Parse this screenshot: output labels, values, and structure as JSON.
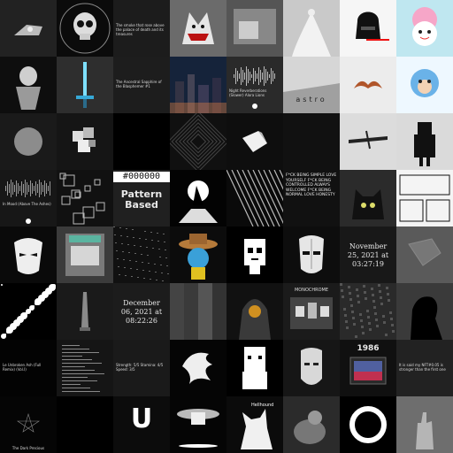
{
  "tiles": [
    {
      "name": "tile-r1c1",
      "bg": "#1a1a1a",
      "motif": "spaceship"
    },
    {
      "name": "tile-r1c2",
      "bg": "#0b0b0b",
      "motif": "skull"
    },
    {
      "name": "tile-r1c3",
      "bg": "#1c1c1c",
      "motif": "tiny-caption",
      "caption": "The smoke that rose above the palace of death and its treasures"
    },
    {
      "name": "tile-r1c4",
      "bg": "#6b6b6b",
      "motif": "wolf"
    },
    {
      "name": "tile-r1c5",
      "bg": "#444",
      "motif": "photo"
    },
    {
      "name": "tile-r1c6",
      "bg": "#bdbdbd",
      "motif": "dancer"
    },
    {
      "name": "tile-r1c7",
      "bg": "#f4f4f4",
      "motif": "vader"
    },
    {
      "name": "tile-r1c8",
      "bg": "#a6e0ee",
      "motif": "cute"
    },
    {
      "name": "tile-r2c1",
      "bg": "#0e0e0e",
      "motif": "figure"
    },
    {
      "name": "tile-r2c2",
      "bg": "#2e2e2e",
      "motif": "sword"
    },
    {
      "name": "tile-r2c3",
      "bg": "#1d1d1d",
      "motif": "tiny-caption",
      "caption": "The Ancestral Sapphire of the Blasphemer #1"
    },
    {
      "name": "tile-r2c4",
      "bg": "#1f2a3a",
      "motif": "city"
    },
    {
      "name": "tile-r2c5",
      "bg": "#2a2a2a",
      "motif": "audio",
      "caption": "Night Reverberations (Slower) Alora Lions"
    },
    {
      "name": "tile-r2c6",
      "bg": "#d6d6d6",
      "motif": "astro",
      "caption": "astro"
    },
    {
      "name": "tile-r2c7",
      "bg": "#e4e4e4",
      "motif": "mustache"
    },
    {
      "name": "tile-r2c8",
      "bg": "#e9f6ff",
      "motif": "ape"
    },
    {
      "name": "tile-r3c1",
      "bg": "#1a1a1a",
      "motif": "circle"
    },
    {
      "name": "tile-r3c2",
      "bg": "#151515",
      "motif": "cubes"
    },
    {
      "name": "tile-r3c3",
      "bg": "#000000",
      "motif": "blank"
    },
    {
      "name": "tile-r3c4",
      "bg": "#101010",
      "motif": "concentric"
    },
    {
      "name": "tile-r3c5",
      "bg": "#0e0e0e",
      "motif": "origami"
    },
    {
      "name": "tile-r3c6",
      "bg": "#111111",
      "motif": "blank"
    },
    {
      "name": "tile-r3c7",
      "bg": "#dcdcdc",
      "motif": "plane"
    },
    {
      "name": "tile-r3c8",
      "bg": "#d9d9d9",
      "motif": "pixel-person"
    },
    {
      "name": "tile-r4c1",
      "bg": "#171717",
      "motif": "audio2",
      "caption": "In Mood (Above The Ashes)"
    },
    {
      "name": "tile-r4c2",
      "bg": "#111111",
      "motif": "squares"
    },
    {
      "name": "tile-r4c3",
      "bg": "#202020",
      "motif": "hex-text",
      "caption": "#000000",
      "caption2": "Pattern Based"
    },
    {
      "name": "tile-r4c4",
      "bg": "#030303",
      "motif": "witch"
    },
    {
      "name": "tile-r4c5",
      "bg": "#0a0a0a",
      "motif": "maze"
    },
    {
      "name": "tile-r4c6",
      "bg": "#111111",
      "motif": "text-wall",
      "caption": "F*CK BEING SIMPLE LOVE YOURSELF F*CK BEING CONTROLLED ALWAYS WELCOME F*CK BEING NORMAL LOVE HONESTY"
    },
    {
      "name": "tile-r4c7",
      "bg": "#2b2b2b",
      "motif": "cat"
    },
    {
      "name": "tile-r4c8",
      "bg": "#f2f2f2",
      "motif": "comic"
    },
    {
      "name": "tile-r5c1",
      "bg": "#0a0a0a",
      "motif": "mask"
    },
    {
      "name": "tile-r5c2",
      "bg": "#3b3b3b",
      "motif": "box"
    },
    {
      "name": "tile-r5c3",
      "bg": "#111111",
      "motif": "noise"
    },
    {
      "name": "tile-r5c4",
      "bg": "#0c0c0c",
      "motif": "cowboy"
    },
    {
      "name": "tile-r5c5",
      "bg": "#000000",
      "motif": "punk"
    },
    {
      "name": "tile-r5c6",
      "bg": "#0d0d0d",
      "motif": "mask2"
    },
    {
      "name": "tile-r5c7",
      "bg": "#181818",
      "motif": "date-text",
      "caption": "November 25, 2021 at 03:27:19"
    },
    {
      "name": "tile-r5c8",
      "bg": "#5a5a5a",
      "motif": "emboss"
    },
    {
      "name": "tile-r6c1",
      "bg": "#000000",
      "motif": "splatter"
    },
    {
      "name": "tile-r6c2",
      "bg": "#1a1a1a",
      "motif": "spire"
    },
    {
      "name": "tile-r6c3",
      "bg": "#1c1c1c",
      "motif": "date-text",
      "caption": "December 06, 2021 at 08:22:26"
    },
    {
      "name": "tile-r6c4",
      "bg": "#222222",
      "motif": "blur"
    },
    {
      "name": "tile-r6c5",
      "bg": "#111111",
      "motif": "hooded"
    },
    {
      "name": "tile-r6c6",
      "bg": "#1b1b1b",
      "motif": "gallery",
      "caption": "MONOCHROME"
    },
    {
      "name": "tile-r6c7",
      "bg": "#2a2a2a",
      "motif": "noise2"
    },
    {
      "name": "tile-r6c8",
      "bg": "#3a3a3a",
      "motif": "silhouette"
    },
    {
      "name": "tile-r7c1",
      "bg": "#030303",
      "motif": "mono-text",
      "caption": "Le Unbroken Ash (Full Remix) (Vol.I)"
    },
    {
      "name": "tile-r7c2",
      "bg": "#151515",
      "motif": "ascii"
    },
    {
      "name": "tile-r7c3",
      "bg": "#1a1a1a",
      "motif": "list",
      "caption": "Strength: 5/5 Stamina: 4/5 Speed: 3/5"
    },
    {
      "name": "tile-r7c4",
      "bg": "#050505",
      "motif": "dragon"
    },
    {
      "name": "tile-r7c5",
      "bg": "#000000",
      "motif": "pixel-face"
    },
    {
      "name": "tile-r7c6",
      "bg": "#161616",
      "motif": "face"
    },
    {
      "name": "tile-r7c7",
      "bg": "#101010",
      "motif": "tv",
      "caption": "1986"
    },
    {
      "name": "tile-r7c8",
      "bg": "#222222",
      "motif": "tiny-caption",
      "caption": "It is said my NFT#0.05 is stronger than the first one"
    },
    {
      "name": "tile-r8c1",
      "bg": "#050505",
      "motif": "star",
      "caption": "The Dark Precious"
    },
    {
      "name": "tile-r8c2",
      "bg": "#000000",
      "motif": "blank"
    },
    {
      "name": "tile-r8c3",
      "bg": "#0c0c0c",
      "motif": "letter",
      "caption": "U"
    },
    {
      "name": "tile-r8c4",
      "bg": "#050505",
      "motif": "lamp"
    },
    {
      "name": "tile-r8c5",
      "bg": "#0b0b0b",
      "motif": "wolf2",
      "caption": "Hellhound"
    },
    {
      "name": "tile-r8c6",
      "bg": "#2b2b2b",
      "motif": "photo2"
    },
    {
      "name": "tile-r8c7",
      "bg": "#000000",
      "motif": "ring"
    },
    {
      "name": "tile-r8c8",
      "bg": "#6e6e6e",
      "motif": "hand"
    }
  ]
}
